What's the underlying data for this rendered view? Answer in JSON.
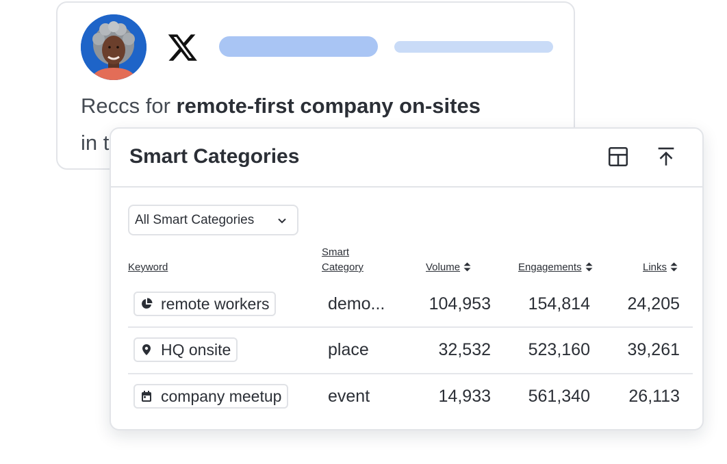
{
  "post": {
    "text_prefix": "Reccs for ",
    "text_bold": "remote-first company on-sites",
    "text_line2": "in t",
    "logo_icon": "x-logo-icon"
  },
  "panel": {
    "title": "Smart Categories",
    "header_icons": [
      "grid-icon",
      "upload-icon"
    ],
    "filter": {
      "selected": "All Smart Categories"
    },
    "columns": {
      "keyword": "Keyword",
      "category_line1": "Smart",
      "category_line2": "Category",
      "volume": "Volume",
      "engagements": "Engagements",
      "links": "Links"
    },
    "rows": [
      {
        "icon": "pie-chart-icon",
        "keyword": "remote workers",
        "category": "demo...",
        "volume": "104,953",
        "engagements": "154,814",
        "links": "24,205"
      },
      {
        "icon": "location-pin-icon",
        "keyword": "HQ onsite",
        "category": "place",
        "volume": "32,532",
        "engagements": "523,160",
        "links": "39,261"
      },
      {
        "icon": "calendar-icon",
        "keyword": "company meetup",
        "category": "event",
        "volume": "14,933",
        "engagements": "561,340",
        "links": "26,113"
      }
    ]
  },
  "colors": {
    "avatar_bg": "#1e64c8",
    "bar_primary": "#a9c5f4",
    "bar_secondary": "#c9dbf7",
    "text": "#2b2f36"
  }
}
